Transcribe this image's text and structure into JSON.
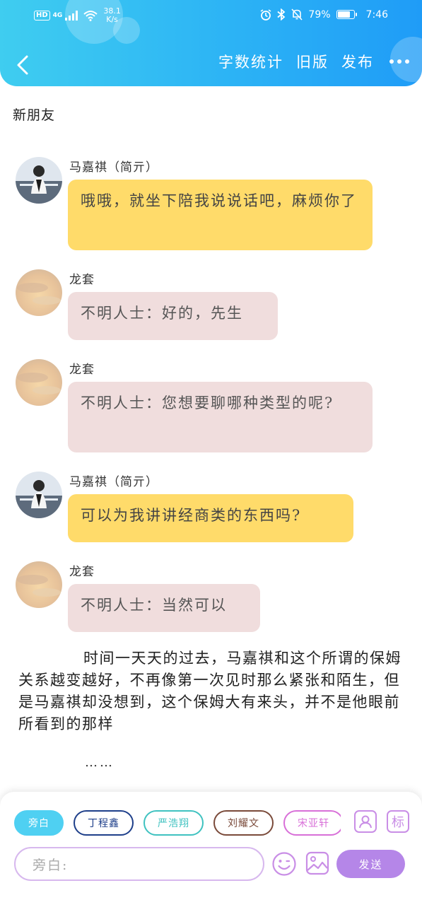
{
  "status_bar": {
    "hd": "HD",
    "signal": "4G",
    "net_speed_value": "38.1",
    "net_speed_unit": "K/s",
    "battery": "79%",
    "time": "7:46"
  },
  "header": {
    "actions": [
      "字数统计",
      "旧版",
      "发布"
    ]
  },
  "doc_title": "新朋友",
  "messages": [
    {
      "name": "马嘉祺（简亓）",
      "text": "哦哦，就坐下陪我说说话吧，麻烦你了",
      "style": "yellow"
    },
    {
      "name": "龙套",
      "text": "不明人士：好的，先生",
      "style": "pink"
    },
    {
      "name": "龙套",
      "text": "不明人士：您想要聊哪种类型的呢?",
      "style": "pink"
    },
    {
      "name": "马嘉祺（简亓）",
      "text": "可以为我讲讲经商类的东西吗?",
      "style": "yellow"
    },
    {
      "name": "龙套",
      "text": "不明人士：当然可以",
      "style": "pink"
    }
  ],
  "narration": "时间一天天的过去，马嘉祺和这个所谓的保姆关系越变越好，不再像第一次见时那么紧张和陌生，但是马嘉祺却没想到，这个保姆大有来头，并不是他眼前所看到的那样",
  "ellipsis": "……",
  "roles": [
    {
      "label": "旁白",
      "color": "#4fd0f2",
      "active": true
    },
    {
      "label": "丁程鑫",
      "color": "#1e3f8a",
      "active": false
    },
    {
      "label": "严浩翔",
      "color": "#3fc2c0",
      "active": false
    },
    {
      "label": "刘耀文",
      "color": "#7a4a3a",
      "active": false
    },
    {
      "label": "宋亚轩",
      "color": "#d86fd8",
      "active": false
    }
  ],
  "side_icons": {
    "person": "person-icon",
    "tag_label": "标"
  },
  "input": {
    "placeholder": "旁白:"
  },
  "send_label": "发送",
  "colors": {
    "header_start": "#3fcdf0",
    "header_end": "#1f9cf7",
    "yellow_bubble": "#ffdb6a",
    "pink_bubble": "#f0dddd",
    "send": "#b586e8"
  }
}
